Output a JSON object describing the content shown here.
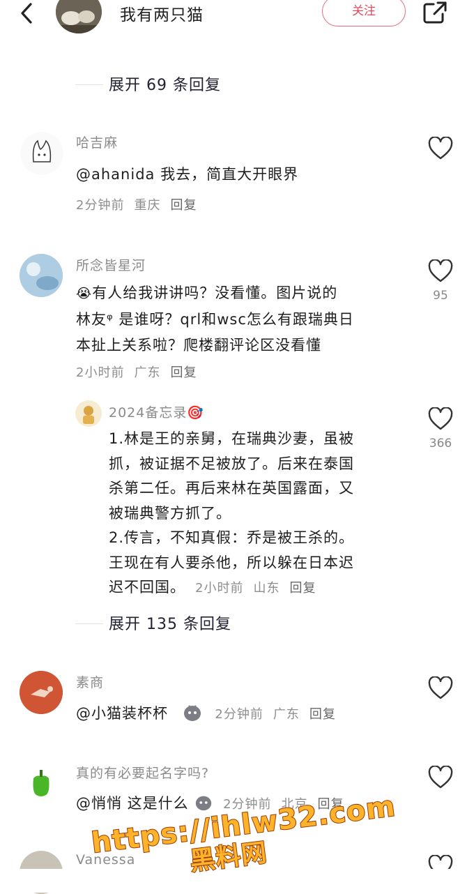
{
  "header": {
    "title": "我有两只猫",
    "follow_label": "关注"
  },
  "top_expand": "展开 69 条回复",
  "comments": [
    {
      "username": "哈吉麻",
      "text": "@ahanida  我去，简直大开眼界",
      "time": "2分钟前",
      "location": "重庆",
      "reply": "回复"
    },
    {
      "username": "所念皆星河",
      "text_lines": [
        "有人给我讲讲吗？没看懂。图片说的",
        "林友ᵠ 是谁呀？qrl和wsc怎么有跟瑞典日",
        "本扯上关系啦？爬楼翻评论区没看懂"
      ],
      "time": "2小时前",
      "location": "广东",
      "reply": "回复",
      "likes": "95",
      "emoji": "😭"
    },
    {
      "username": "素商",
      "text": "@小猫装杯杯",
      "time": "2分钟前",
      "location": "广东",
      "reply": "回复"
    },
    {
      "username": "真的有必要起名字吗?",
      "text": "@悄悄  这是什么",
      "time": "2分钟前",
      "location": "北京",
      "reply": "回复"
    },
    {
      "username": "Vanessa"
    }
  ],
  "sub_reply": {
    "username": "2024备忘录🎯",
    "lines": [
      "1.林是王的亲舅，在瑞典沙妻，虽被",
      "抓，被证据不足被放了。后来在泰国",
      "杀第二任。再后来林在英国露面，又",
      "被瑞典警方抓了。",
      "2.传言，不知真假：乔是被王杀的。",
      "王现在有人要杀他，所以躲在日本迟",
      "迟不回国。"
    ],
    "time": "2小时前",
    "location": "山东",
    "reply": "回复",
    "likes": "366"
  },
  "mid_expand": "展开 135 条回复",
  "watermark": {
    "line1": "https://ihlw32.com",
    "line2": "黑料网"
  },
  "colors": {
    "accent": "#e24a5e",
    "meta": "#8e8e8e",
    "watermark": "#ffb32a"
  }
}
